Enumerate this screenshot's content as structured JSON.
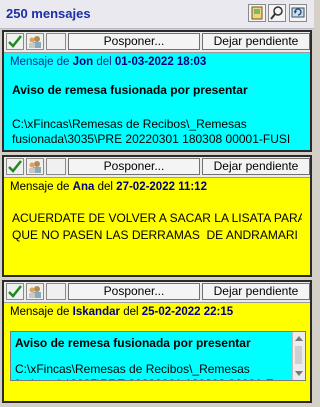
{
  "window": {
    "title": "250 mensajes",
    "icons": [
      "card-icon",
      "search-icon",
      "refresh-icon"
    ]
  },
  "buttons": {
    "posponer": "Posponer...",
    "dejar": "Dejar pendiente"
  },
  "messages": [
    {
      "prefix": "Mensaje de",
      "from": "Jon",
      "date_prefix": "del",
      "date": "01-03-2022 18:03",
      "color": "#00ffff",
      "subject": "Aviso de remesa fusionada por presentar",
      "body": "C:\\xFincas\\Remesas de Recibos\\_Remesas\nfusionada\\3035\\PRE 20220301 180308 00001-FUSI"
    },
    {
      "prefix": "Mensaje de",
      "from": "Ana",
      "date_prefix": "del",
      "date": "27-02-2022 11:12",
      "color": "#ffff00",
      "subject": "",
      "body": "ACUERDATE DE VOLVER A SACAR LA LISATA PARA\nQUE NO PASEN LAS DERRAMAS  DE ANDRAMARI"
    },
    {
      "prefix": "Mensaje de",
      "from": "Iskandar",
      "date_prefix": "del",
      "date": "25-02-2022 22:15",
      "color": "#ffff00",
      "subject": "Aviso de remesa fusionada por presentar",
      "body": "C:\\xFincas\\Remesas de Recibos\\_Remesas\nfusionada\\3035\\PRE 20220301 180308 00001-F"
    }
  ]
}
